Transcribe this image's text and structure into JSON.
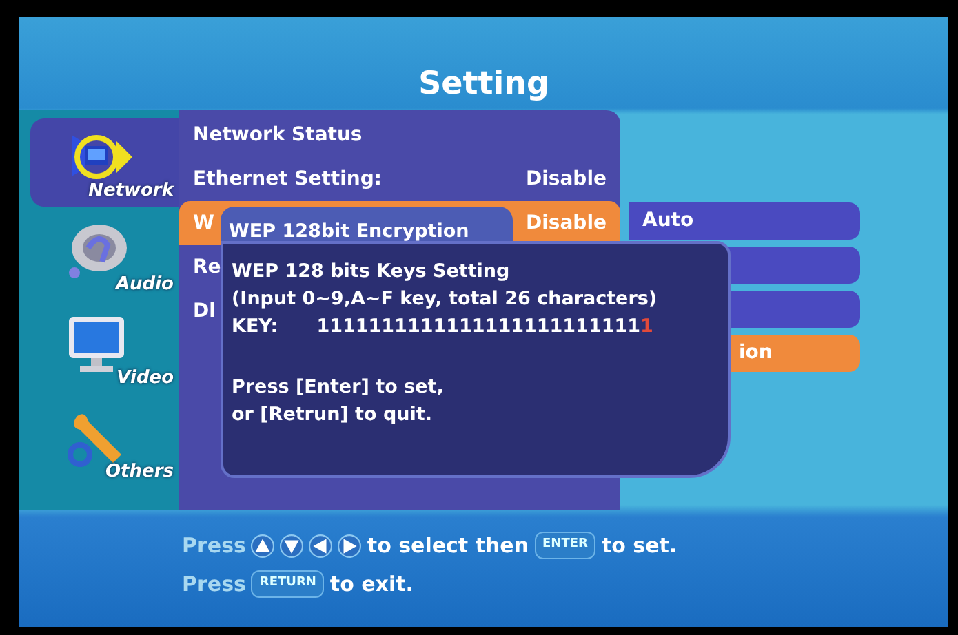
{
  "title": "Setting",
  "sidebar": [
    {
      "label": "Network",
      "selected": true
    },
    {
      "label": "Audio",
      "selected": false
    },
    {
      "label": "Video",
      "selected": false
    },
    {
      "label": "Others",
      "selected": false
    }
  ],
  "menu": [
    {
      "label": "Network Status",
      "selected": false
    },
    {
      "label": "Ethernet Setting:",
      "value": "Disable",
      "selected": false
    },
    {
      "label": "W",
      "value": "Disable",
      "selected": true
    },
    {
      "label": "Re",
      "selected": false
    },
    {
      "label": "Dl",
      "selected": false
    }
  ],
  "submenu": [
    {
      "label": "Auto",
      "selected": false
    },
    {
      "selected": false
    },
    {
      "selected": false
    },
    {
      "label": "ion",
      "selected": true
    }
  ],
  "popup": {
    "title": "WEP 128bit Encryption",
    "heading": "WEP 128 bits Keys Setting",
    "hint": "(Input 0~9,A~F key, total 26 characters)",
    "key_label": "KEY:",
    "key_value": "1111111111111111111111111",
    "key_cursor": "1",
    "instructions": [
      "Press [Enter] to set,",
      "or [Retrun] to quit."
    ]
  },
  "footer": [
    [
      {
        "kind": "text",
        "text": "Press",
        "dim": true
      },
      {
        "kind": "up"
      },
      {
        "kind": "down"
      },
      {
        "kind": "left"
      },
      {
        "kind": "right"
      },
      {
        "kind": "text",
        "text": "to select then"
      },
      {
        "kind": "key",
        "text": "ENTER"
      },
      {
        "kind": "text",
        "text": "to set."
      }
    ],
    [
      {
        "kind": "text",
        "text": "Press",
        "dim": true
      },
      {
        "kind": "key",
        "text": "RETURN"
      },
      {
        "kind": "text",
        "text": "to exit."
      }
    ]
  ]
}
